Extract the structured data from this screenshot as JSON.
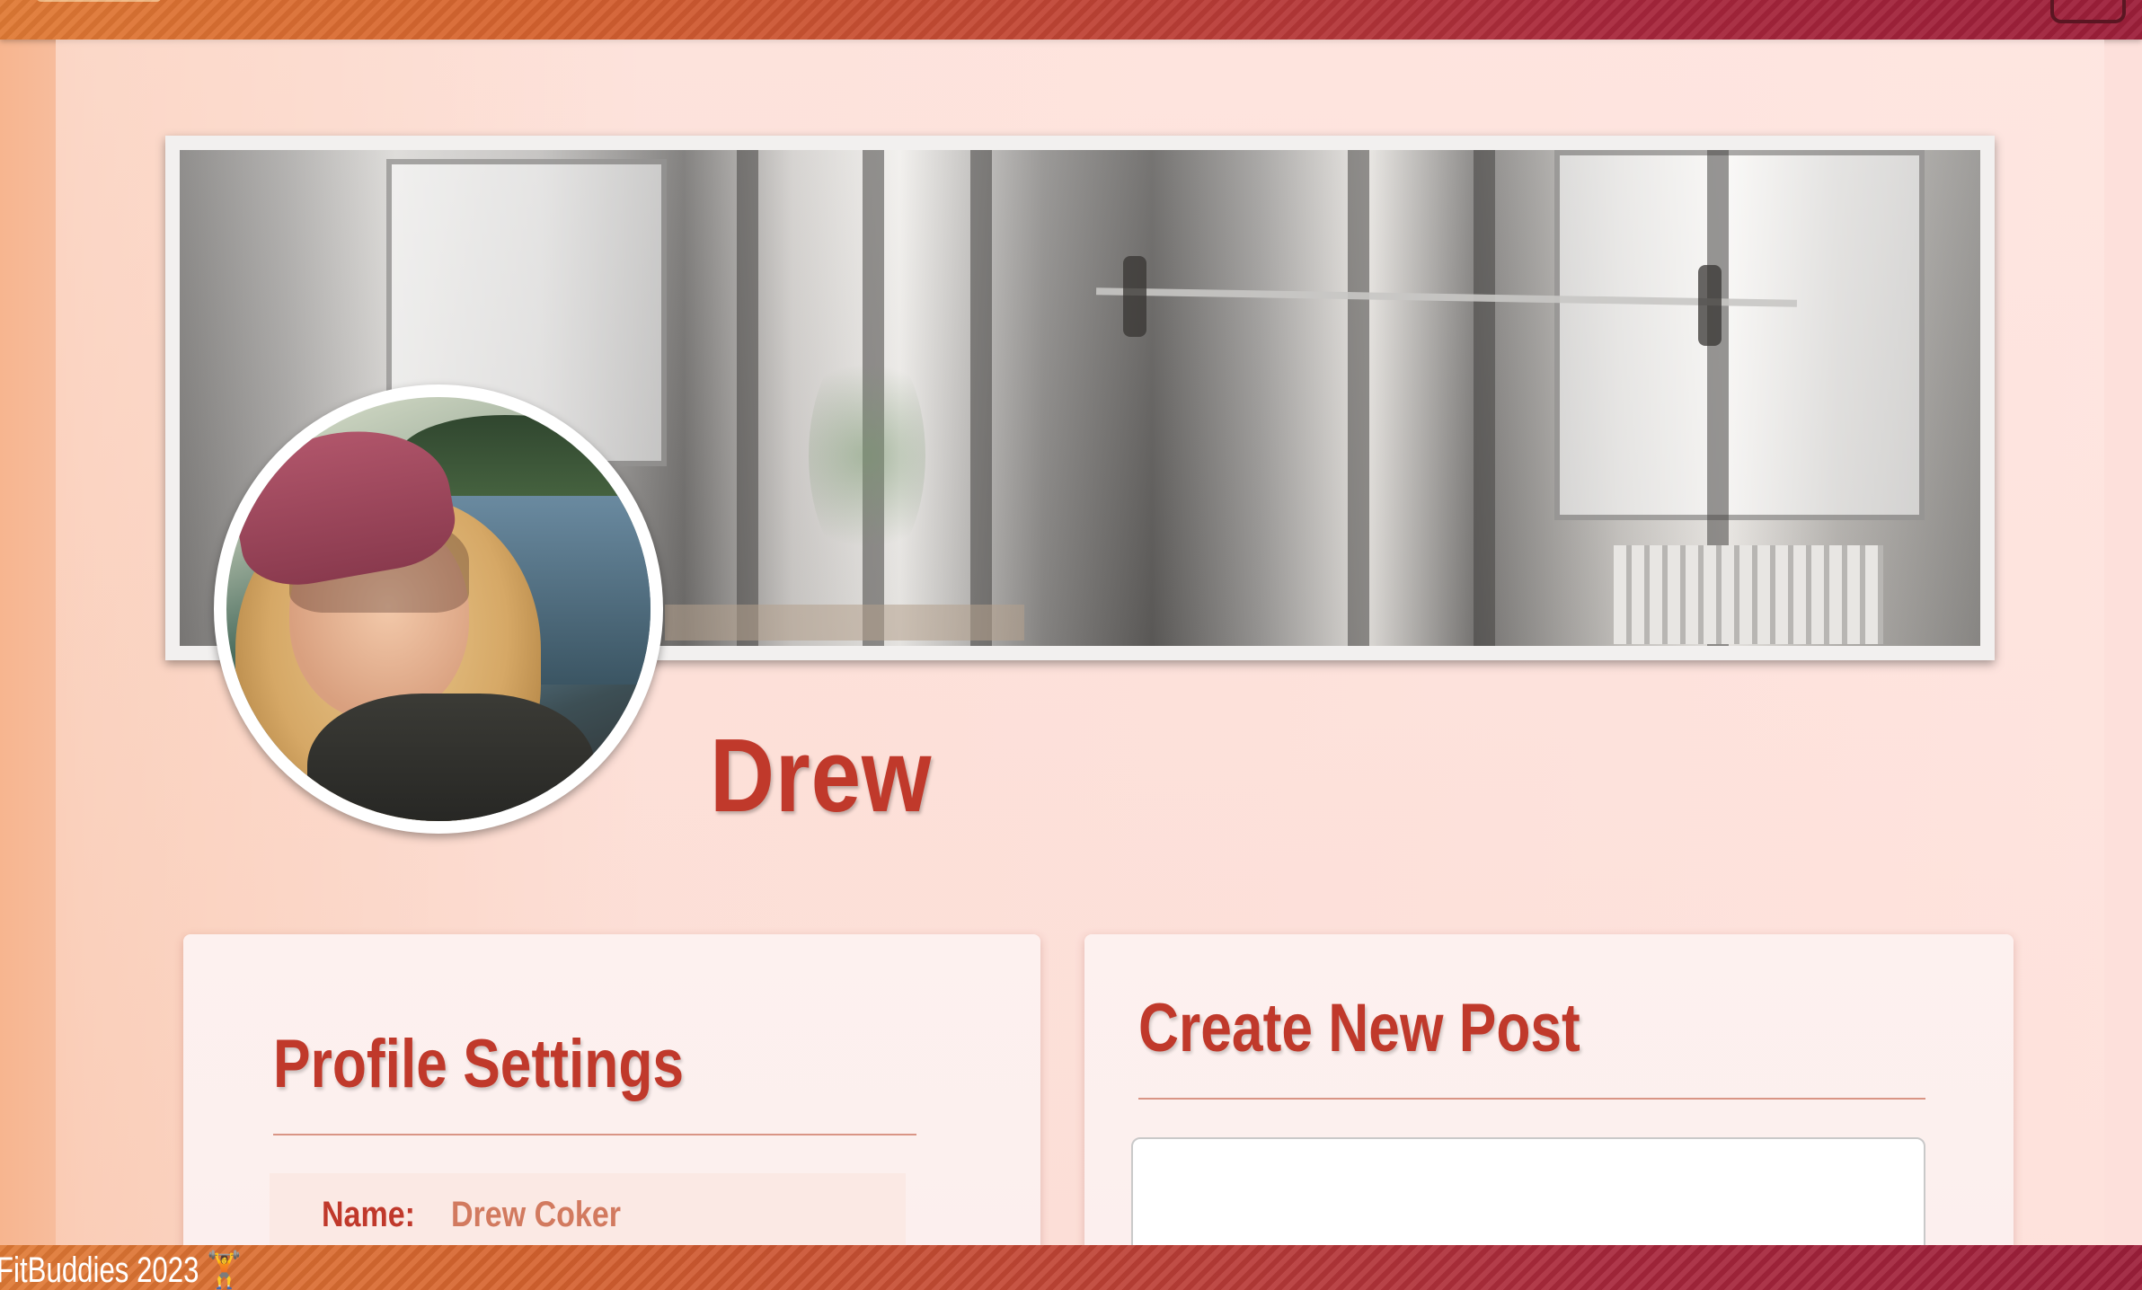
{
  "profile": {
    "display_name": "Drew",
    "banner_alt": "Gym banner",
    "avatar_alt": "Profile photo"
  },
  "settings_card": {
    "title": "Profile Settings",
    "fields": [
      {
        "label": "Name:",
        "value": "Drew Coker"
      }
    ]
  },
  "post_card": {
    "title": "Create New Post",
    "input_value": ""
  },
  "footer": {
    "text": "FitBuddies 2023 🏋"
  },
  "colors": {
    "accent": "#c0392b",
    "bar_start": "#e07a35",
    "bar_end": "#9d1f3a"
  }
}
